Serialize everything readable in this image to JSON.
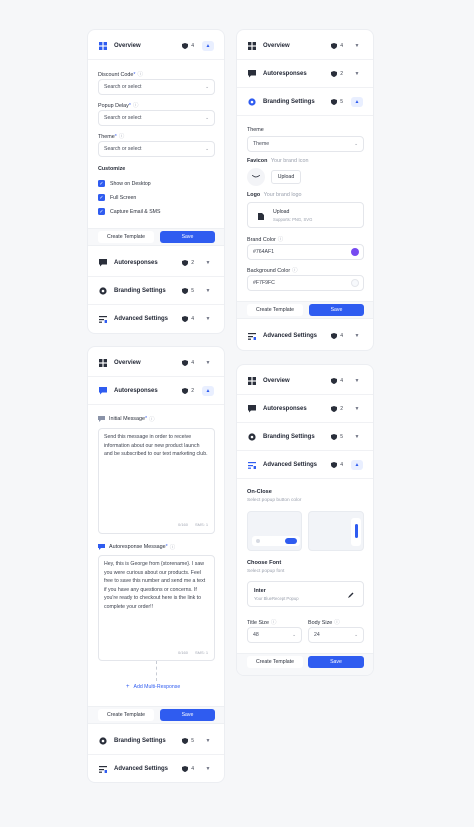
{
  "panel_a": {
    "rows": {
      "overview": {
        "title": "Overview",
        "count": "4"
      },
      "autoresponses": {
        "title": "Autoresponses",
        "count": "2"
      },
      "branding": {
        "title": "Branding Settings",
        "count": "5"
      },
      "advanced": {
        "title": "Advanced Settings",
        "count": "4"
      }
    },
    "discount_label": "Discount Code",
    "discount_placeholder": "Search or select",
    "popup_delay_label": "Popup Delay",
    "popup_delay_placeholder": "Search or select",
    "theme_label": "Theme",
    "theme_placeholder": "Search or select",
    "customize_label": "Customize",
    "checks": [
      "Show on Desktop",
      "Full Screen",
      "Capture Email & SMS"
    ],
    "create_template": "Create Template",
    "save": "Save"
  },
  "panel_b": {
    "rows": {
      "overview": {
        "title": "Overview",
        "count": "4"
      },
      "autoresponses": {
        "title": "Autoresponses",
        "count": "2"
      },
      "branding": {
        "title": "Branding Settings",
        "count": "5"
      },
      "advanced": {
        "title": "Advanced Settings",
        "count": "4"
      }
    },
    "theme_label": "Theme",
    "theme_value": "Theme",
    "favicon_label": "Favicon",
    "favicon_sub": "Your brand icon",
    "upload": "Upload",
    "logo_label": "Logo",
    "logo_sub": "Your brand logo",
    "logo_upload": "Upload",
    "logo_supports": "Supports: PNG, SVG",
    "brand_color_label": "Brand Color",
    "brand_color_value": "#764AF1",
    "bg_color_label": "Background Color",
    "bg_color_value": "#F7F9FC",
    "create_template": "Create Template",
    "save": "Save"
  },
  "panel_c": {
    "rows": {
      "overview": {
        "title": "Overview",
        "count": "4"
      },
      "autoresponses": {
        "title": "Autoresponses",
        "count": "2"
      },
      "branding": {
        "title": "Branding Settings",
        "count": "5"
      },
      "advanced": {
        "title": "Advanced Settings",
        "count": "4"
      }
    },
    "initial_label": "Initial Message",
    "initial_text": "Send this message in order to receive information about our new product launch and be subscribed to our text marketing club.",
    "initial_chars": "0/160",
    "initial_sms": "SMS: 1",
    "auto_label": "Autoresponse Message",
    "auto_text": "Hey, this is George from {storename}. I saw you were curious about our products. Feel free to save this number and send me a text if you have any questions or concerns. If you're ready to checkout here is the link to complete your order!!",
    "auto_chars": "0/160",
    "auto_sms": "SMS: 1",
    "add_multi": "Add Multi-Response",
    "create_template": "Create Template",
    "save": "Save"
  },
  "panel_d": {
    "rows": {
      "overview": {
        "title": "Overview",
        "count": "4"
      },
      "autoresponses": {
        "title": "Autoresponses",
        "count": "2"
      },
      "branding": {
        "title": "Branding Settings",
        "count": "5"
      },
      "advanced": {
        "title": "Advanced Settings",
        "count": "4"
      }
    },
    "onclose_label": "On-Close",
    "onclose_sub": "Select popup button color",
    "font_label": "Choose Font",
    "font_sub": "Select popup font",
    "font_name": "Inter",
    "font_desc": "Your BlueRecept Popup",
    "title_size_label": "Title Size",
    "title_size_value": "48",
    "body_size_label": "Body Size",
    "body_size_value": "24",
    "create_template": "Create Template",
    "save": "Save"
  },
  "colors": {
    "accent": "#2F5CF0",
    "brand_swatch": "#764AF1",
    "bg_swatch": "#F7F9FC"
  }
}
